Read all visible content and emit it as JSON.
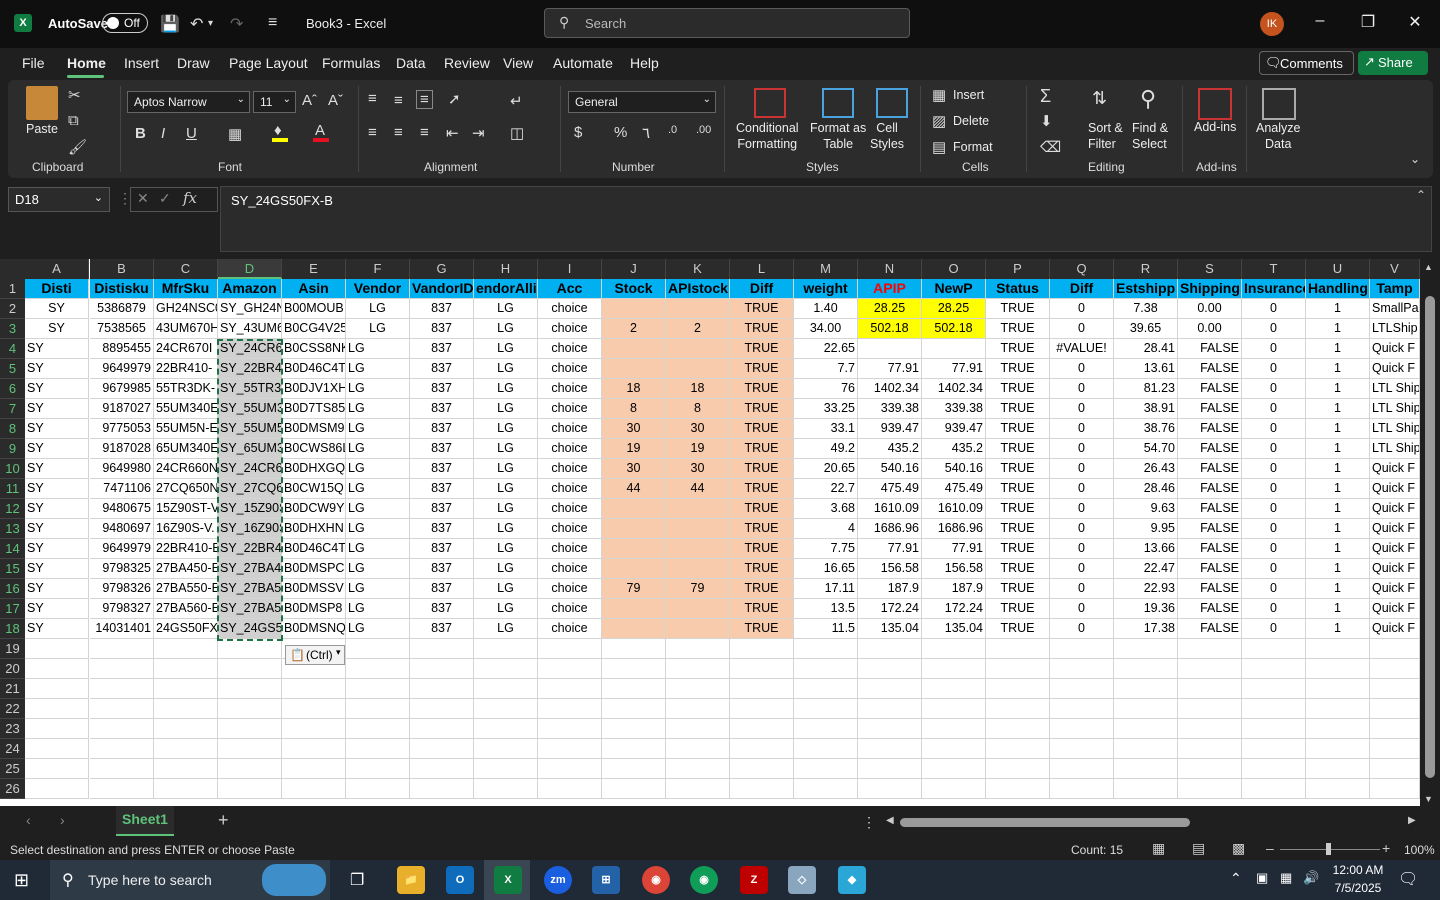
{
  "titlebar": {
    "autosave_label": "AutoSave",
    "autosave_state": "Off",
    "doc_title": "Book3  -  Excel",
    "search_placeholder": "Search",
    "user_initials": "IK"
  },
  "menu": {
    "items": [
      "File",
      "Home",
      "Insert",
      "Draw",
      "Page Layout",
      "Formulas",
      "Data",
      "Review",
      "View",
      "Automate",
      "Help"
    ],
    "active": "Home",
    "comments_label": "Comments",
    "share_label": "Share"
  },
  "ribbon": {
    "clipboard": {
      "paste_label": "Paste",
      "group_label": "Clipboard"
    },
    "font": {
      "font_name": "Aptos Narrow",
      "font_size": "11",
      "group_label": "Font"
    },
    "alignment": {
      "group_label": "Alignment"
    },
    "number": {
      "format": "General",
      "group_label": "Number"
    },
    "styles": {
      "conditional_formatting": "Conditional\nFormatting",
      "format_as_table": "Format as\nTable",
      "cell_styles": "Cell\nStyles",
      "group_label": "Styles"
    },
    "cells": {
      "insert": "Insert",
      "delete": "Delete",
      "format": "Format",
      "group_label": "Cells"
    },
    "editing": {
      "sort_filter": "Sort &\nFilter",
      "find_select": "Find &\nSelect",
      "group_label": "Editing"
    },
    "addins": {
      "addins_label": "Add-ins",
      "group_label": "Add-ins"
    },
    "analyze": {
      "label": "Analyze\nData"
    }
  },
  "formula_bar": {
    "name_box": "D18",
    "formula": "SY_24GS50FX-B"
  },
  "columns": [
    "A",
    "B",
    "C",
    "D",
    "E",
    "F",
    "G",
    "H",
    "I",
    "J",
    "K",
    "L",
    "M",
    "N",
    "O",
    "P",
    "Q",
    "R",
    "S",
    "T",
    "U",
    "V"
  ],
  "header_row": [
    "Disti",
    "Distisku",
    "MfrSku",
    "Amazon",
    "Asin",
    "Vendor",
    "VandorID",
    "endorAllia",
    "Acc",
    "Stock",
    "APIstock",
    "Diff",
    "weight",
    "APIP",
    "NewP",
    "Status",
    "Diff",
    "Estshipp",
    "Shipping",
    "Insurance",
    "Handling",
    "Tamp"
  ],
  "rows": [
    [
      "SY",
      "5386879",
      "GH24NSC0",
      "SY_GH24N",
      "B00MOUB",
      "LG",
      "837",
      "LG",
      "choice",
      "",
      "",
      "TRUE",
      "1.40",
      "28.25",
      "28.25",
      "TRUE",
      "0",
      "7.38",
      "0.00",
      "0",
      "1",
      "SmallPa"
    ],
    [
      "SY",
      "7538565",
      "43UM670H",
      "SY_43UM6",
      "B0CG4V25",
      "LG",
      "837",
      "LG",
      "choice",
      "2",
      "2",
      "TRUE",
      "34.00",
      "502.18",
      "502.18",
      "TRUE",
      "0",
      "39.65",
      "0.00",
      "0",
      "1",
      "LTLShip"
    ],
    [
      "SY",
      "8895455",
      "24CR670I",
      "SY_24CR67",
      "B0CSS8NK",
      "LG",
      "837",
      "LG",
      "choice",
      "",
      "",
      "TRUE",
      "22.65",
      "",
      "",
      "TRUE",
      "#VALUE!",
      "28.41",
      "FALSE",
      "0",
      "1",
      "Quick F"
    ],
    [
      "SY",
      "9649979",
      "22BR410-",
      "SY_22BR41",
      "B0D46C4T",
      "LG",
      "837",
      "LG",
      "choice",
      "",
      "",
      "TRUE",
      "7.7",
      "77.91",
      "77.91",
      "TRUE",
      "0",
      "13.61",
      "FALSE",
      "0",
      "1",
      "Quick F"
    ],
    [
      "SY",
      "9679985",
      "55TR3DK-",
      "SY_55TR3D",
      "B0DJV1XH",
      "LG",
      "837",
      "LG",
      "choice",
      "18",
      "18",
      "TRUE",
      "76",
      "1402.34",
      "1402.34",
      "TRUE",
      "0",
      "81.23",
      "FALSE",
      "0",
      "1",
      "LTL Ship"
    ],
    [
      "SY",
      "9187027",
      "55UM340E",
      "SY_55UM3",
      "B0D7TS85",
      "LG",
      "837",
      "LG",
      "choice",
      "8",
      "8",
      "TRUE",
      "33.25",
      "339.38",
      "339.38",
      "TRUE",
      "0",
      "38.91",
      "FALSE",
      "0",
      "1",
      "LTL Ship"
    ],
    [
      "SY",
      "9775053",
      "55UM5N-E",
      "SY_55UM5",
      "B0DMSM9",
      "LG",
      "837",
      "LG",
      "choice",
      "30",
      "30",
      "TRUE",
      "33.1",
      "939.47",
      "939.47",
      "TRUE",
      "0",
      "38.76",
      "FALSE",
      "0",
      "1",
      "LTL Ship"
    ],
    [
      "SY",
      "9187028",
      "65UM340E",
      "SY_65UM3",
      "B0CWS86L",
      "LG",
      "837",
      "LG",
      "choice",
      "19",
      "19",
      "TRUE",
      "49.2",
      "435.2",
      "435.2",
      "TRUE",
      "0",
      "54.70",
      "FALSE",
      "0",
      "1",
      "LTL Ship"
    ],
    [
      "SY",
      "9649980",
      "24CR660N",
      "SY_24CR66",
      "B0DHXGQ",
      "LG",
      "837",
      "LG",
      "choice",
      "30",
      "30",
      "TRUE",
      "20.65",
      "540.16",
      "540.16",
      "TRUE",
      "0",
      "26.43",
      "FALSE",
      "0",
      "1",
      "Quick F"
    ],
    [
      "SY",
      "7471106",
      "27CQ650N",
      "SY_27CQ6",
      "B0CW15Q",
      "LG",
      "837",
      "LG",
      "choice",
      "44",
      "44",
      "TRUE",
      "22.7",
      "475.49",
      "475.49",
      "TRUE",
      "0",
      "28.46",
      "FALSE",
      "0",
      "1",
      "Quick F"
    ],
    [
      "SY",
      "9480675",
      "15Z90ST-V",
      "SY_15Z90S",
      "B0DCW9Y",
      "LG",
      "837",
      "LG",
      "choice",
      "",
      "",
      "TRUE",
      "3.68",
      "1610.09",
      "1610.09",
      "TRUE",
      "0",
      "9.63",
      "FALSE",
      "0",
      "1",
      "Quick F"
    ],
    [
      "SY",
      "9480697",
      "16Z90S-V.",
      "SY_16Z90S",
      "B0DHXHN",
      "LG",
      "837",
      "LG",
      "choice",
      "",
      "",
      "TRUE",
      "4",
      "1686.96",
      "1686.96",
      "TRUE",
      "0",
      "9.95",
      "FALSE",
      "0",
      "1",
      "Quick F"
    ],
    [
      "SY",
      "9649979",
      "22BR410-E",
      "SY_22BR41",
      "B0D46C4T",
      "LG",
      "837",
      "LG",
      "choice",
      "",
      "",
      "TRUE",
      "7.75",
      "77.91",
      "77.91",
      "TRUE",
      "0",
      "13.66",
      "FALSE",
      "0",
      "1",
      "Quick F"
    ],
    [
      "SY",
      "9798325",
      "27BA450-E",
      "SY_27BA45",
      "B0DMSPC",
      "LG",
      "837",
      "LG",
      "choice",
      "",
      "",
      "TRUE",
      "16.65",
      "156.58",
      "156.58",
      "TRUE",
      "0",
      "22.47",
      "FALSE",
      "0",
      "1",
      "Quick F"
    ],
    [
      "SY",
      "9798326",
      "27BA550-E",
      "SY_27BA55",
      "B0DMSSV",
      "LG",
      "837",
      "LG",
      "choice",
      "79",
      "79",
      "TRUE",
      "17.11",
      "187.9",
      "187.9",
      "TRUE",
      "0",
      "22.93",
      "FALSE",
      "0",
      "1",
      "Quick F"
    ],
    [
      "SY",
      "9798327",
      "27BA560-E",
      "SY_27BA56",
      "B0DMSP8",
      "LG",
      "837",
      "LG",
      "choice",
      "",
      "",
      "TRUE",
      "13.5",
      "172.24",
      "172.24",
      "TRUE",
      "0",
      "19.36",
      "FALSE",
      "0",
      "1",
      "Quick F"
    ],
    [
      "SY",
      "14031401",
      "24GS50FX",
      "SY_24GS50",
      "B0DMSNQ",
      "LG",
      "837",
      "LG",
      "choice",
      "",
      "",
      "TRUE",
      "11.5",
      "135.04",
      "135.04",
      "TRUE",
      "0",
      "17.38",
      "FALSE",
      "0",
      "1",
      "Quick F"
    ]
  ],
  "row_numbers": [
    "1",
    "2",
    "3",
    "4",
    "5",
    "6",
    "7",
    "8",
    "9",
    "10",
    "11",
    "12",
    "13",
    "14",
    "15",
    "16",
    "17",
    "18",
    "19",
    "20",
    "21",
    "22",
    "23",
    "24",
    "25",
    "26"
  ],
  "paste_options_label": "(Ctrl)",
  "sheet_tab": "Sheet1",
  "statusbar": {
    "message": "Select destination and press ENTER or choose Paste",
    "count": "Count: 15",
    "zoom": "100%"
  },
  "taskbar": {
    "search_placeholder": "Type here to search",
    "time": "12:00 AM",
    "date": "7/5/2025"
  }
}
